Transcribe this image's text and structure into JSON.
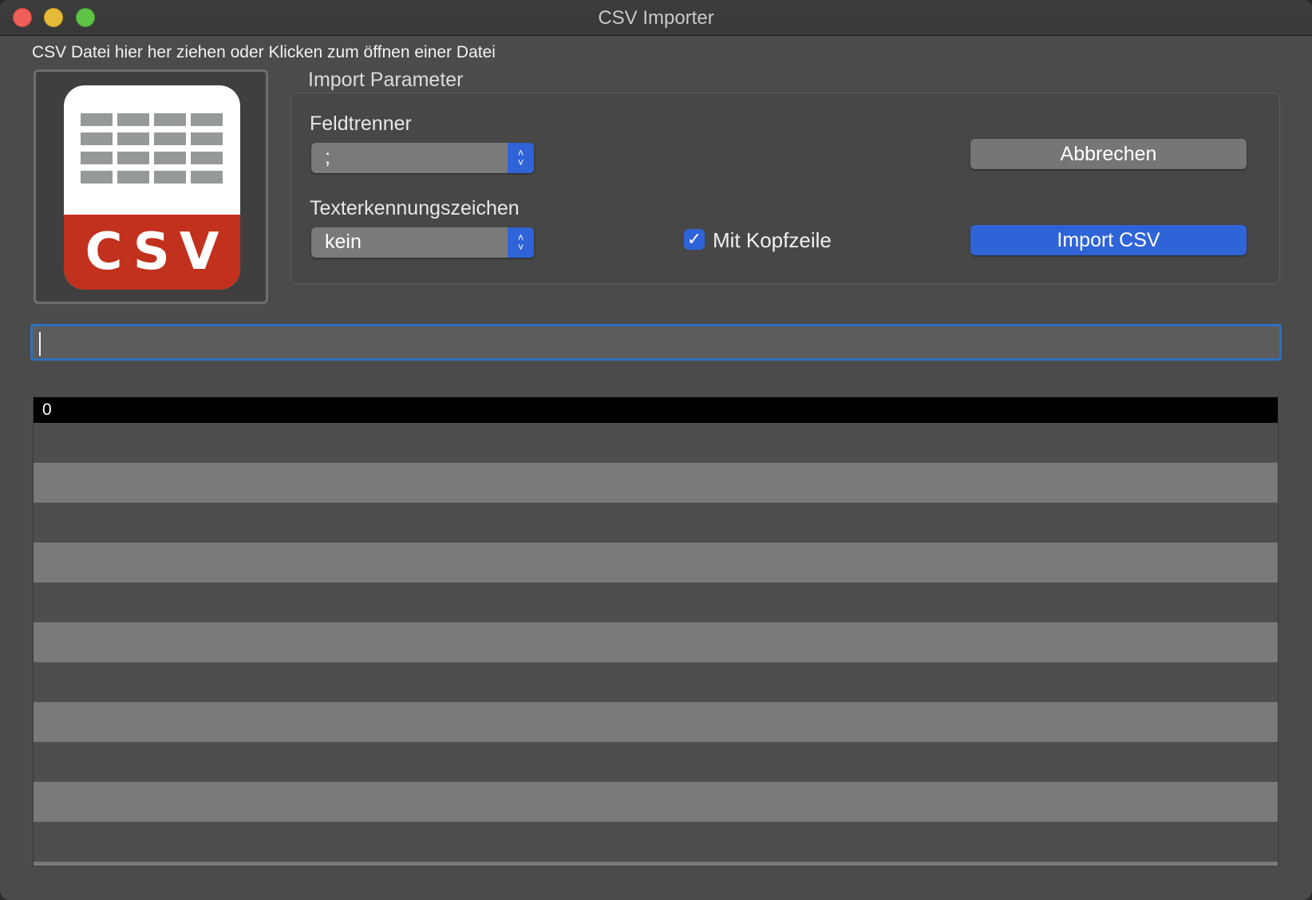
{
  "window": {
    "title": "CSV Importer"
  },
  "drop_area": {
    "hint": "CSV Datei hier her ziehen oder Klicken zum öffnen einer Datei",
    "icon": "csv-file-icon",
    "icon_text": "CSV",
    "colors": {
      "band": "#c1311d",
      "grid": "#959a99"
    }
  },
  "import_parameter": {
    "title": "Import Parameter",
    "field_separator": {
      "label": "Feldtrenner",
      "value": ";"
    },
    "text_qualifier": {
      "label": "Texterkennungszeichen",
      "value": "kein"
    },
    "header_row": {
      "label": "Mit Kopfzeile",
      "checked": true
    }
  },
  "buttons": {
    "cancel": "Abbrechen",
    "import": "Import CSV"
  },
  "path_field": {
    "value": ""
  },
  "table": {
    "columns": [
      "0"
    ],
    "rows": []
  },
  "colors": {
    "accent": "#2f64d8",
    "focus_ring": "#2f6fbd"
  }
}
